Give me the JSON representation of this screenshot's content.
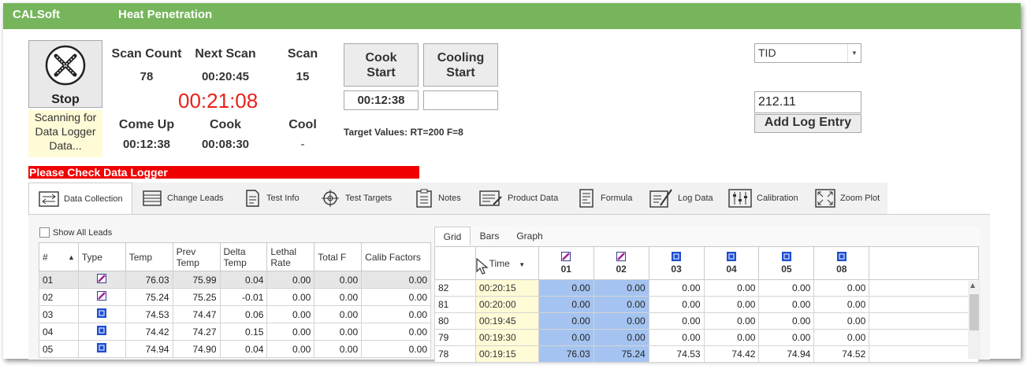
{
  "window": {
    "app": "CALSoft",
    "module": "Heat Penetration"
  },
  "stop_button": {
    "label": "Stop"
  },
  "status": {
    "line1": "Scanning for",
    "line2": "Data Logger",
    "line3": "Data..."
  },
  "counters": {
    "scan_count_label": "Scan Count",
    "scan_count": "78",
    "next_scan_label": "Next Scan",
    "next_scan": "00:20:45",
    "scan_label": "Scan",
    "scan": "15",
    "big_time": "00:21:08",
    "come_up_label": "Come Up",
    "come_up": "00:12:38",
    "cook_label": "Cook",
    "cook": "00:08:30",
    "cool_label": "Cool",
    "cool": "-"
  },
  "cook_start": {
    "line1": "Cook",
    "line2": "Start",
    "value": "00:12:38"
  },
  "cooling_start": {
    "line1": "Cooling",
    "line2": "Start",
    "value": ""
  },
  "target_values": "Target Values: RT=200  F=8",
  "warning": "Please Check Data Logger",
  "tid_select": {
    "value": "TID"
  },
  "log_value": "212.11",
  "add_log_entry": "Add Log Entry",
  "tabs": [
    {
      "label": "Data Collection",
      "icon": "data-collection-icon"
    },
    {
      "label": "Change Leads",
      "icon": "change-leads-icon"
    },
    {
      "label": "Test Info",
      "icon": "test-info-icon"
    },
    {
      "label": "Test Targets",
      "icon": "target-icon"
    },
    {
      "label": "Notes",
      "icon": "notes-icon"
    },
    {
      "label": "Product Data",
      "icon": "product-data-icon"
    },
    {
      "label": "Formula",
      "icon": "formula-icon"
    },
    {
      "label": "Log Data",
      "icon": "log-data-icon"
    },
    {
      "label": "Calibration",
      "icon": "calibration-icon"
    },
    {
      "label": "Zoom Plot",
      "icon": "zoom-plot-icon"
    }
  ],
  "show_all_leads": "Show All Leads",
  "leads_table": {
    "headers": [
      "#",
      "Type",
      "Temp",
      "Prev Temp",
      "Delta Temp",
      "Lethal Rate",
      "Total F",
      "Calib Factors"
    ],
    "rows": [
      {
        "num": "01",
        "type": "thermocouple",
        "temp": "76.03",
        "prev": "75.99",
        "delta": "0.04",
        "lethal": "0.00",
        "total": "0.00",
        "calib": "0.00"
      },
      {
        "num": "02",
        "type": "thermocouple",
        "temp": "75.24",
        "prev": "75.25",
        "delta": "-0.01",
        "lethal": "0.00",
        "total": "0.00",
        "calib": "0.00"
      },
      {
        "num": "03",
        "type": "logger",
        "temp": "74.53",
        "prev": "74.47",
        "delta": "0.06",
        "lethal": "0.00",
        "total": "0.00",
        "calib": "0.00"
      },
      {
        "num": "04",
        "type": "logger",
        "temp": "74.42",
        "prev": "74.27",
        "delta": "0.15",
        "lethal": "0.00",
        "total": "0.00",
        "calib": "0.00"
      },
      {
        "num": "05",
        "type": "logger",
        "temp": "74.94",
        "prev": "74.90",
        "delta": "0.04",
        "lethal": "0.00",
        "total": "0.00",
        "calib": "0.00"
      }
    ]
  },
  "right_tabs": [
    "Grid",
    "Bars",
    "Graph"
  ],
  "grid_table": {
    "time_header": "Time",
    "columns": [
      "01",
      "02",
      "03",
      "04",
      "05",
      "08"
    ],
    "rows": [
      {
        "scan": "82",
        "time": "00:20:15",
        "values": [
          "0.00",
          "0.00",
          "0.00",
          "0.00",
          "0.00",
          "0.00"
        ]
      },
      {
        "scan": "81",
        "time": "00:20:00",
        "values": [
          "0.00",
          "0.00",
          "0.00",
          "0.00",
          "0.00",
          "0.00"
        ]
      },
      {
        "scan": "80",
        "time": "00:19:45",
        "values": [
          "0.00",
          "0.00",
          "0.00",
          "0.00",
          "0.00",
          "0.00"
        ]
      },
      {
        "scan": "79",
        "time": "00:19:30",
        "values": [
          "0.00",
          "0.00",
          "0.00",
          "0.00",
          "0.00",
          "0.00"
        ]
      },
      {
        "scan": "78",
        "time": "00:19:15",
        "values": [
          "76.03",
          "75.24",
          "74.53",
          "74.42",
          "74.94",
          "74.52"
        ]
      }
    ]
  },
  "colors": {
    "title_bar": "#76b55b",
    "warning": "#f00000",
    "big_time": "#e8211b",
    "highlight": "#a4c3f0",
    "time_cell": "#fffbd6"
  }
}
